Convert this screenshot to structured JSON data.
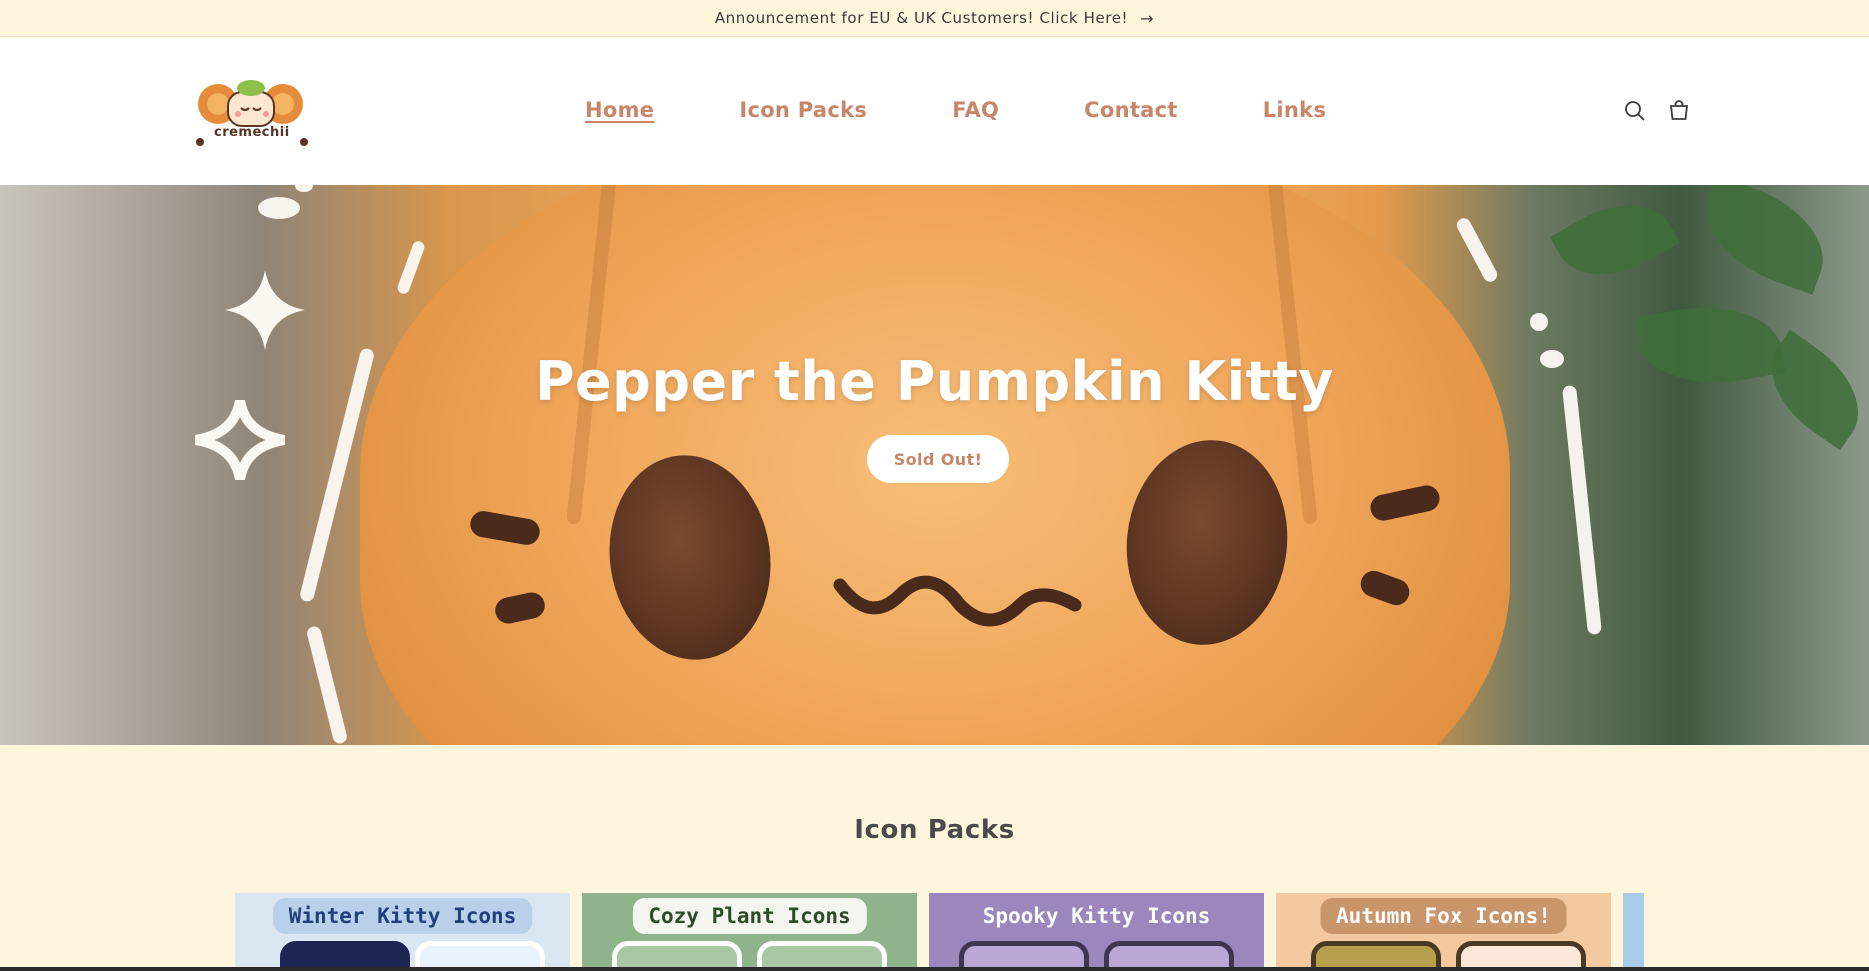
{
  "announcement": {
    "text": "Announcement for EU & UK Customers! Click Here!",
    "arrow": "→"
  },
  "brand": {
    "name": "cremechii"
  },
  "nav": {
    "items": [
      {
        "label": "Home",
        "active": true
      },
      {
        "label": "Icon Packs",
        "active": false
      },
      {
        "label": "FAQ",
        "active": false
      },
      {
        "label": "Contact",
        "active": false
      },
      {
        "label": "Links",
        "active": false
      }
    ]
  },
  "header_icons": [
    "search-icon",
    "cart-icon"
  ],
  "hero": {
    "title": "Pepper the Pumpkin Kitty",
    "button_label": "Sold Out!"
  },
  "icon_packs": {
    "title": "Icon Packs",
    "cards": [
      {
        "label": "Winter Kitty Icons",
        "bg": "#dbe6f3",
        "pill_bg": "#b9d0ea",
        "text_color": "#22407a",
        "phone": "#1d2552"
      },
      {
        "label": "Cozy Plant Icons",
        "bg": "#8fb48b",
        "pill_bg": "#f3f6ee",
        "text_color": "#2e4b2a",
        "phone": "#ffffff"
      },
      {
        "label": "Spooky Kitty Icons",
        "bg": "#9b86be",
        "pill_bg": "#9b86be",
        "text_color": "#ffffff",
        "phone": "#3f3552"
      },
      {
        "label": "Autumn Fox Icons!",
        "bg": "#f4c9a0",
        "pill_bg": "#c9956a",
        "text_color": "#ffffff",
        "phone": "#4a3a24"
      }
    ]
  },
  "colors": {
    "accent": "#c7866a",
    "page_bg": "#fdf6dc",
    "header_bg": "#ffffff"
  }
}
